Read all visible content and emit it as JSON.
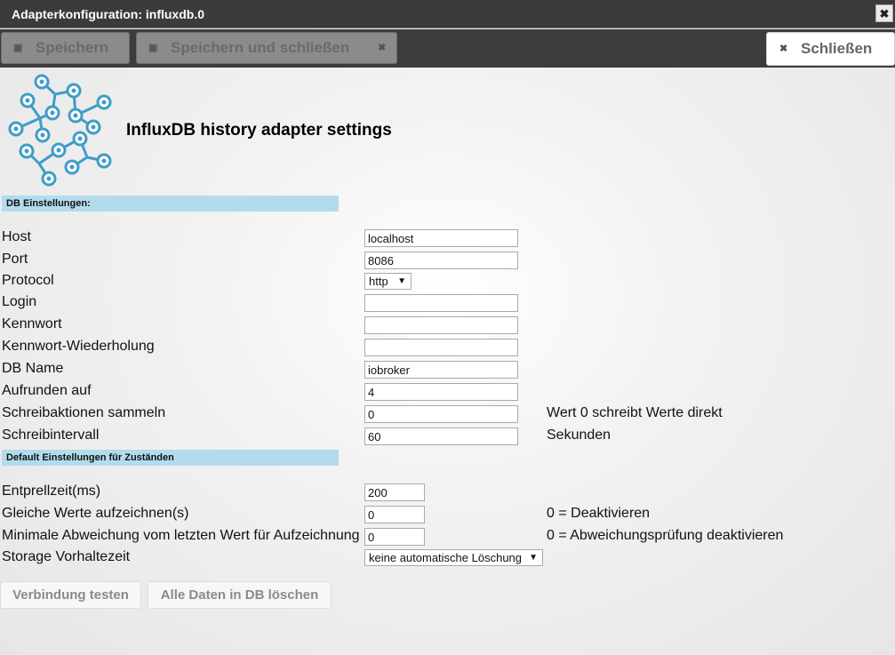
{
  "window": {
    "title": "Adapterkonfiguration: influxdb.0",
    "close_glyph": "✖"
  },
  "toolbar": {
    "save_label": "Speichern",
    "save_close_label": "Speichern und schließen",
    "close_label": "Schließen",
    "save_icon": "save-icon",
    "close_icon_glyph": "✖"
  },
  "header": {
    "title": "InfluxDB history adapter settings"
  },
  "sections": {
    "db": "DB Einstellungen:",
    "defaults": "Default Einstellungen für Zuständen"
  },
  "fields": {
    "host": {
      "label": "Host",
      "value": "localhost"
    },
    "port": {
      "label": "Port",
      "value": "8086"
    },
    "protocol": {
      "label": "Protocol",
      "value": "http"
    },
    "login": {
      "label": "Login",
      "value": ""
    },
    "password": {
      "label": "Kennwort",
      "value": ""
    },
    "password_repeat": {
      "label": "Kennwort-Wiederholung",
      "value": ""
    },
    "db_name": {
      "label": "DB Name",
      "value": "iobroker"
    },
    "round": {
      "label": "Aufrunden auf",
      "value": "4"
    },
    "collect_writes": {
      "label": "Schreibaktionen sammeln",
      "value": "0",
      "hint": "Wert 0 schreibt Werte direkt"
    },
    "write_interval": {
      "label": "Schreibintervall",
      "value": "60",
      "hint": "Sekunden"
    },
    "debounce": {
      "label": "Entprellzeit(ms)",
      "value": "200"
    },
    "same_values": {
      "label": "Gleiche Werte aufzeichnen(s)",
      "value": "0",
      "hint": "0 = Deaktivieren"
    },
    "min_change": {
      "label": "Minimale Abweichung vom letzten Wert für Aufzeichnung",
      "value": "0",
      "hint": "0 = Abweichungsprüfung deaktivieren"
    },
    "retention": {
      "label": "Storage Vorhaltezeit",
      "value": "keine automatische Löschung"
    }
  },
  "actions": {
    "test_connection": "Verbindung testen",
    "delete_all": "Alle Daten in DB löschen"
  },
  "colors": {
    "section_bar": "#b2dcec",
    "logo": "#3f9dc7",
    "titlebar": "#3b3b3b"
  }
}
